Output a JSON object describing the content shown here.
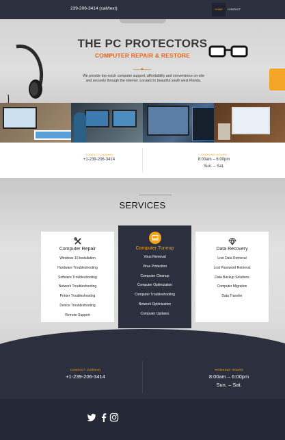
{
  "topbar": {
    "phone": "239-206-3414 (call/text)",
    "nav": [
      {
        "label": "HOME"
      },
      {
        "label": "CONTACT"
      }
    ]
  },
  "hero": {
    "title": "THE PC PROTECTORS",
    "subtitle": "COMPUTER REPAIR & RESTORE",
    "description": "We provide top-notch computer support, affordability and convenience on-site and securely through the internet. Located in beautiful south west Florida."
  },
  "contact_band": {
    "contact_label": "CONTACT (call/text)",
    "contact_value": "+1-239-206-3414",
    "hours_label": "WORKING HOURS",
    "hours_time": "8:00am – 6:00pm",
    "hours_days": "Sun. – Sat."
  },
  "services": {
    "title": "SERVICES",
    "cards": [
      {
        "title": "Computer Repair",
        "icon": "tools-icon",
        "items": [
          "Windows 10 Installation",
          "Hardware Troubleshooting",
          "Software Troubleshooting",
          "Network Troubleshooting",
          "Printer Troubleshooting",
          "Device Troubleshooting",
          "Remote Support"
        ]
      },
      {
        "title": "Computer Tuneup",
        "icon": "laptop-icon",
        "items": [
          "Virus Removal",
          "Virus Protection",
          "Computer Cleanup",
          "Computer Optimization",
          "Computer Troubleshooting",
          "Network Optimization",
          "Computer Updates"
        ]
      },
      {
        "title": "Data Recovery",
        "icon": "diamond-icon",
        "items": [
          "Lost Data Retrieval",
          "Lost Password Retrieval",
          "Data Backup Solutions",
          "Computer Migration",
          "Data Transfer"
        ]
      }
    ]
  },
  "footer_contact": {
    "contact_label": "CONTACT (call/text)",
    "contact_value": "+1-239-206-3414",
    "hours_label": "WORKING HOURS",
    "hours_time": "8:00am – 6:00pm",
    "hours_days": "Sun. – Sat."
  },
  "social": [
    "twitter-icon",
    "facebook-icon",
    "instagram-icon"
  ],
  "colors": {
    "accent": "#f2a51a",
    "dark": "#2c2f3d",
    "hero_subtitle": "#e06620"
  }
}
